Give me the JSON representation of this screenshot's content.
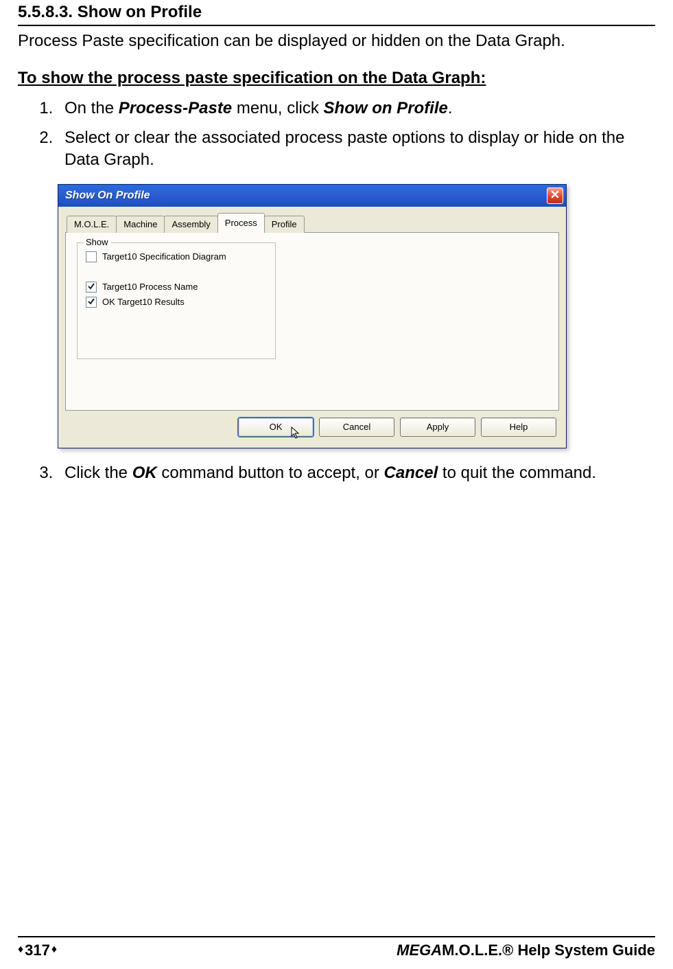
{
  "doc": {
    "section_number": "5.5.8.3.",
    "section_title": "Show on Profile",
    "intro": "Process Paste specification can be displayed or hidden on the Data Graph.",
    "procedure_heading": "To show the process paste specification on the Data Graph:",
    "steps": {
      "one_prefix": "On the ",
      "one_menu": "Process-Paste",
      "one_middle": " menu, click ",
      "one_action": "Show on Profile",
      "one_suffix": ".",
      "two": "Select or clear the associated process paste options to display or hide on the Data Graph.",
      "three_prefix": "Click the ",
      "three_ok": "OK",
      "three_middle": " command button to accept, or ",
      "three_cancel": "Cancel",
      "three_suffix": " to quit the command."
    }
  },
  "dialog": {
    "title": "Show On Profile",
    "tabs": {
      "mole": "M.O.L.E.",
      "machine": "Machine",
      "assembly": "Assembly",
      "process": "Process",
      "profile": "Profile"
    },
    "group_label": "Show",
    "options": {
      "spec_diagram": {
        "label": "Target10 Specification Diagram",
        "checked": false
      },
      "process_name": {
        "label": "Target10 Process Name",
        "checked": true
      },
      "ok_results": {
        "label": "OK Target10 Results",
        "checked": true
      }
    },
    "buttons": {
      "ok": "OK",
      "cancel": "Cancel",
      "apply": "Apply",
      "help": "Help"
    }
  },
  "footer": {
    "page": "317",
    "product_italic": "MEGA",
    "product_rest": "M.O.L.E.® Help System Guide"
  }
}
